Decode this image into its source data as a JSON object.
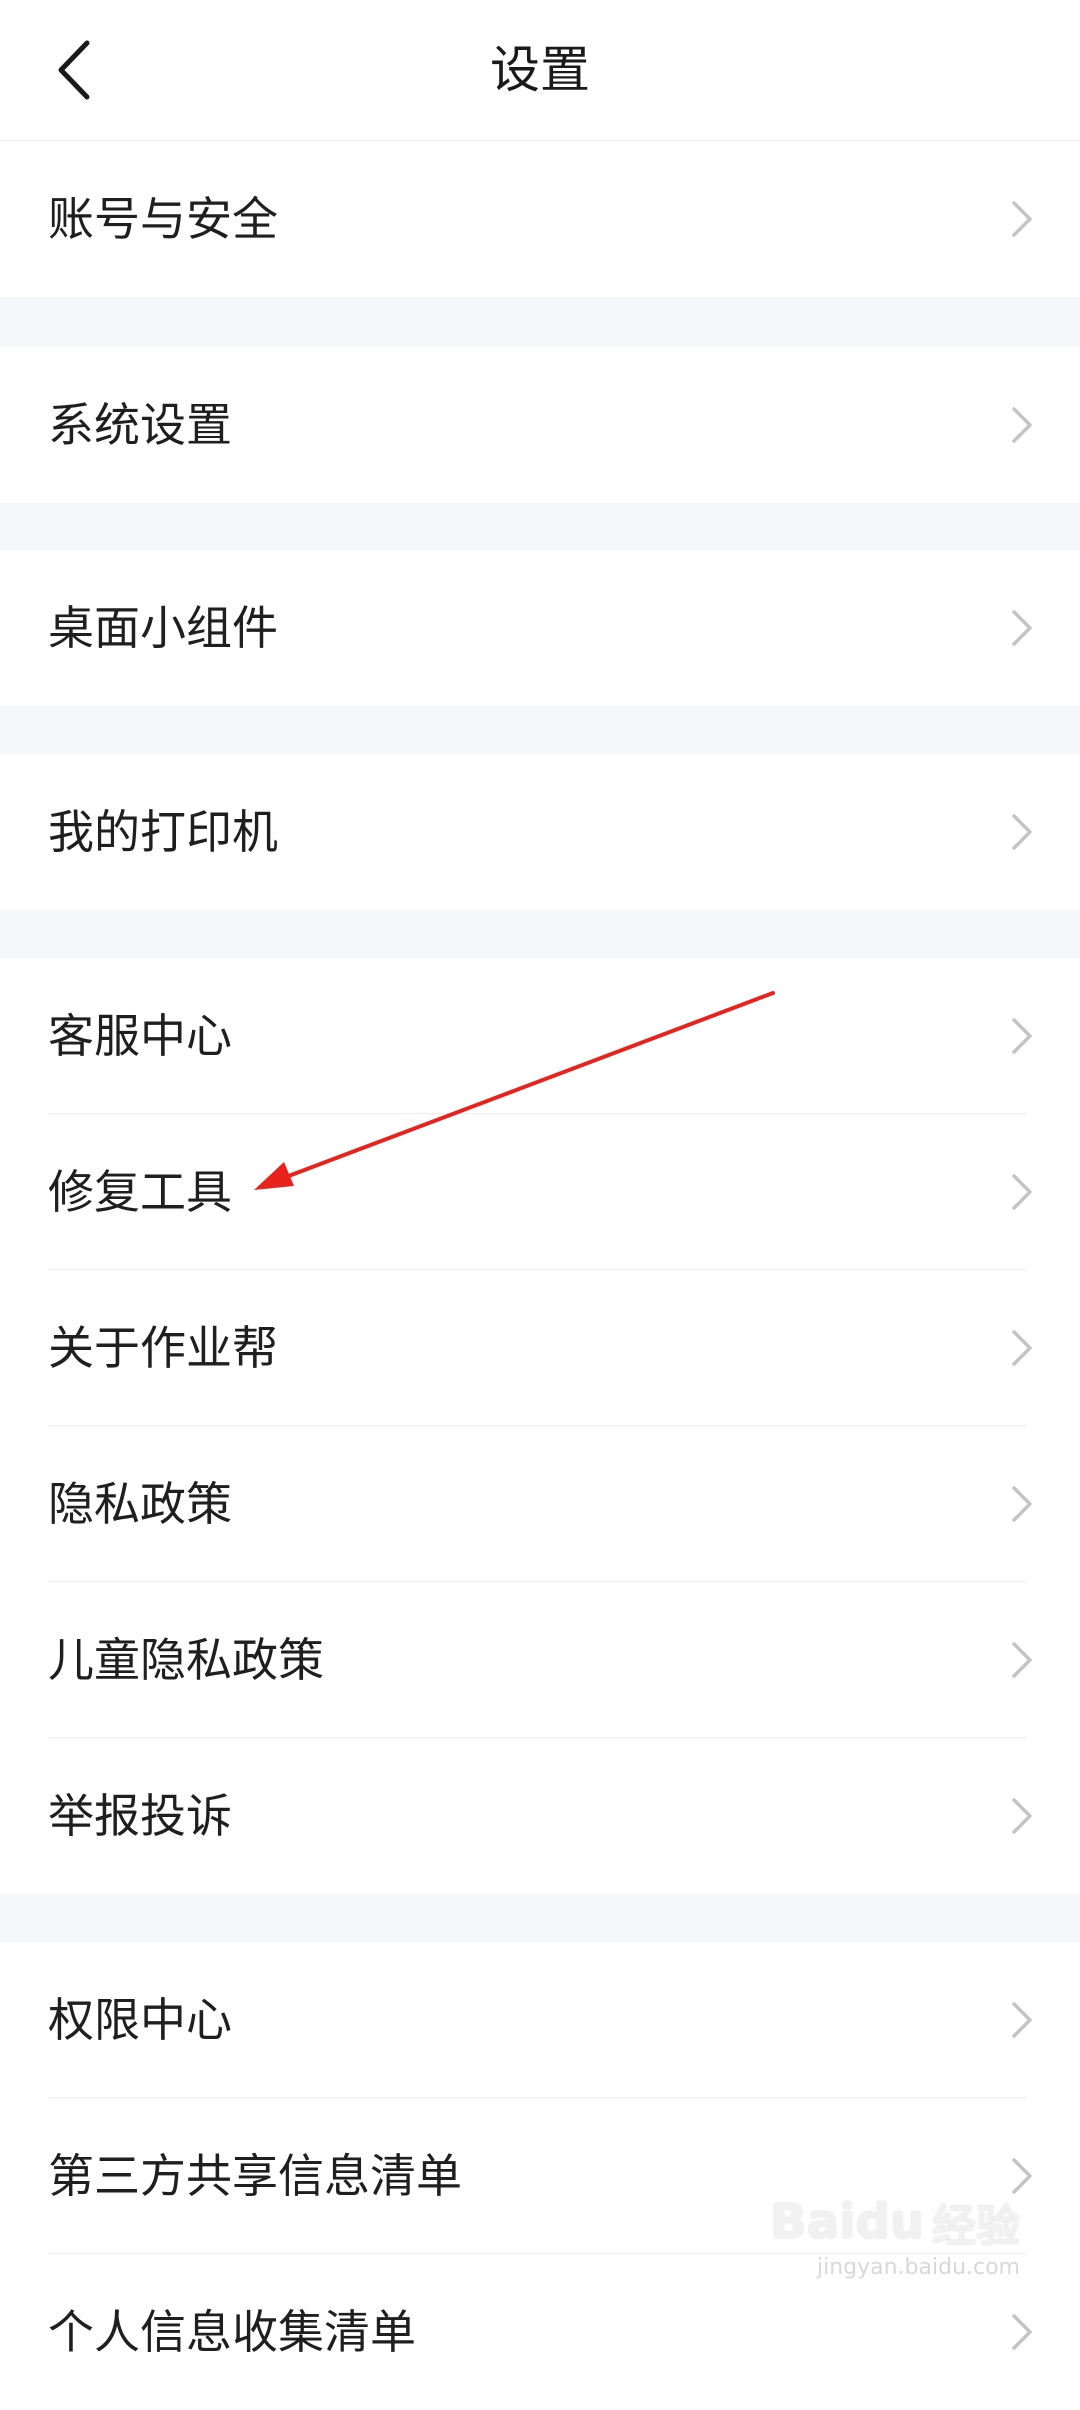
{
  "header": {
    "title": "设置",
    "back_icon": "chevron-left-icon"
  },
  "groups": [
    {
      "items": [
        {
          "label": "账号与安全"
        }
      ]
    },
    {
      "items": [
        {
          "label": "系统设置"
        }
      ]
    },
    {
      "items": [
        {
          "label": "桌面小组件"
        }
      ]
    },
    {
      "items": [
        {
          "label": "我的打印机"
        }
      ]
    },
    {
      "items": [
        {
          "label": "客服中心"
        },
        {
          "label": "修复工具"
        },
        {
          "label": "关于作业帮"
        },
        {
          "label": "隐私政策"
        },
        {
          "label": "儿童隐私政策"
        },
        {
          "label": "举报投诉"
        }
      ]
    },
    {
      "items": [
        {
          "label": "权限中心"
        },
        {
          "label": "第三方共享信息清单"
        },
        {
          "label": "个人信息收集清单"
        }
      ]
    }
  ],
  "annotation": {
    "type": "arrow",
    "color": "#e8231e",
    "points_to": "修复工具"
  },
  "watermark": {
    "brand": "Baidu",
    "sub": "经验",
    "url": "jingyan.baidu.com"
  },
  "colors": {
    "background": "#f6f7fb",
    "row_background": "#ffffff",
    "text": "#1f1f1f",
    "chevron": "#c4c4c4",
    "divider": "#ececec"
  }
}
